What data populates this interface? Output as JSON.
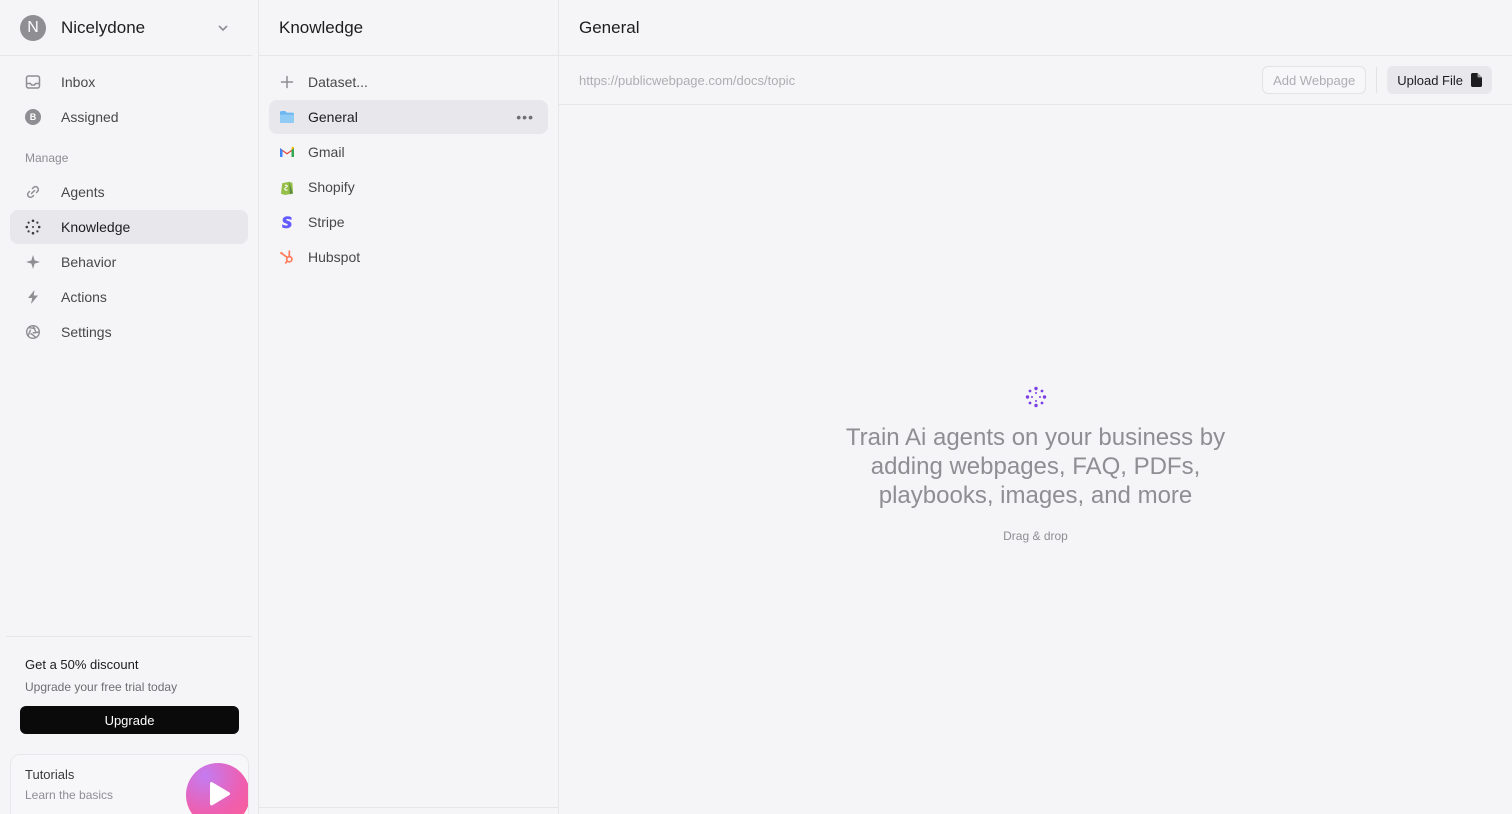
{
  "workspace": {
    "initial": "N",
    "name": "Nicelydone"
  },
  "nav": {
    "top": [
      {
        "label": "Inbox",
        "icon": "inbox-icon"
      },
      {
        "label": "Assigned",
        "icon": "assigned-badge-icon",
        "badge": "B"
      }
    ],
    "section_label": "Manage",
    "manage": [
      {
        "label": "Agents",
        "icon": "link-icon"
      },
      {
        "label": "Knowledge",
        "icon": "dotted-circle-icon",
        "active": true
      },
      {
        "label": "Behavior",
        "icon": "sparkle-icon"
      },
      {
        "label": "Actions",
        "icon": "bolt-icon"
      },
      {
        "label": "Settings",
        "icon": "aperture-icon"
      }
    ]
  },
  "promo": {
    "title": "Get a 50% discount",
    "subtitle": "Upgrade your free trial today",
    "button": "Upgrade"
  },
  "tutorials": {
    "title": "Tutorials",
    "subtitle": "Learn the basics"
  },
  "knowledge": {
    "title": "Knowledge",
    "items": [
      {
        "label": "Dataset...",
        "icon": "plus-icon"
      },
      {
        "label": "General",
        "icon": "folder-icon",
        "active": true
      },
      {
        "label": "Gmail",
        "icon": "gmail-icon"
      },
      {
        "label": "Shopify",
        "icon": "shopify-icon"
      },
      {
        "label": "Stripe",
        "icon": "stripe-icon"
      },
      {
        "label": "Hubspot",
        "icon": "hubspot-icon"
      }
    ]
  },
  "main": {
    "title": "General",
    "url_placeholder": "https://publicwebpage.com/docs/topic",
    "add_webpage": "Add Webpage",
    "upload_file": "Upload File",
    "empty_title": "Train Ai agents on your business by adding webpages, FAQ, PDFs, playbooks, images, and more",
    "empty_subtitle": "Drag & drop"
  },
  "colors": {
    "accent_purple": "#7b3fe4",
    "upgrade_button": "#0a0a0a",
    "folder_blue": "#6cb8ef",
    "gmail_red": "#ea4335",
    "shopify_green": "#95bf47",
    "stripe_purple": "#635bff",
    "hubspot_orange": "#ff7a59"
  }
}
